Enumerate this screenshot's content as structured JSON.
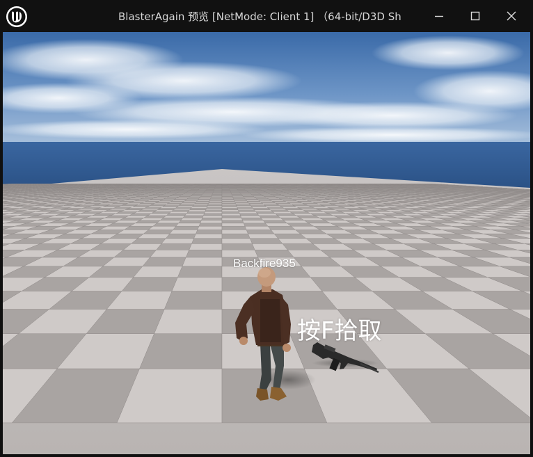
{
  "window": {
    "title": "BlasterAgain 预览 [NetMode: Client 1]  （64-bit/D3D Sh",
    "app_icon": "unreal-engine-logo-icon",
    "controls": {
      "minimize_icon": "minimize-icon",
      "maximize_icon": "maximize-icon",
      "close_icon": "close-icon"
    }
  },
  "hud": {
    "player_name": "Backfire935",
    "pickup_prompt": "按F拾取"
  },
  "colors": {
    "titlebar": "#111111",
    "sky_top": "#3a6aa8",
    "sea": "#2f5b8f",
    "floor_light": "#cfcac8",
    "floor_dark": "#a9a4a2"
  }
}
